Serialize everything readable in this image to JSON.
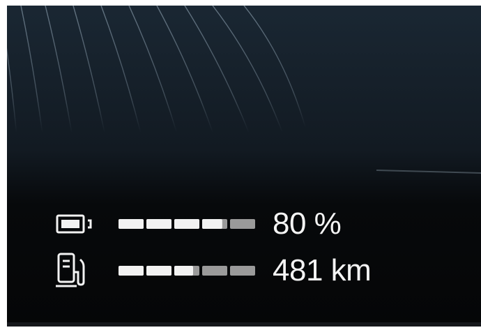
{
  "battery": {
    "icon": "battery-icon",
    "level_percent": 80,
    "value": "80",
    "unit": " %"
  },
  "fuel": {
    "icon": "fuel-pump-icon",
    "range_fraction": 0.55,
    "value": "481",
    "unit": " km"
  },
  "colors": {
    "background": "#0b0d10",
    "segment_full": "#f2f2f2",
    "segment_empty": "#9a9a9a",
    "text": "#f4f4f4"
  }
}
